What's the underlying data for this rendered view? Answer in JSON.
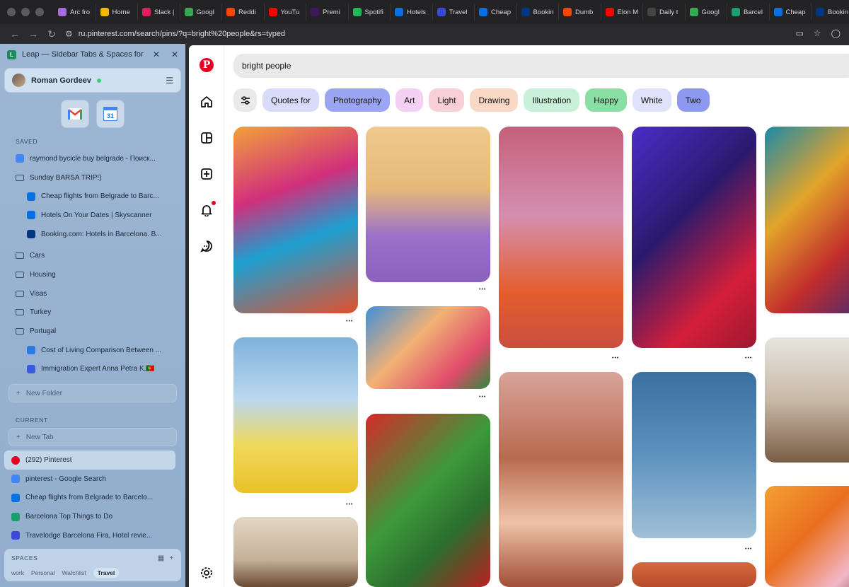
{
  "tabs": [
    {
      "label": "Arc fro",
      "icon": "arc-icon",
      "color": "#a56ddc"
    },
    {
      "label": "Home",
      "icon": "drive-icon",
      "color": "#f4b400"
    },
    {
      "label": "Slack |",
      "icon": "slack-icon",
      "color": "#e01e5a"
    },
    {
      "label": "Googl",
      "icon": "maps-icon",
      "color": "#34a853"
    },
    {
      "label": "Reddi",
      "icon": "reddit-icon",
      "color": "#ff4500"
    },
    {
      "label": "YouTu",
      "icon": "youtube-icon",
      "color": "#ff0000"
    },
    {
      "label": "Premi",
      "icon": "premier-icon",
      "color": "#3d195b"
    },
    {
      "label": "Spotifi",
      "icon": "spotify-icon",
      "color": "#1db954"
    },
    {
      "label": "Hotels",
      "icon": "skyscanner-icon",
      "color": "#0770e3"
    },
    {
      "label": "Travel",
      "icon": "travelodge-icon",
      "color": "#3b49d6"
    },
    {
      "label": "Cheap",
      "icon": "skyscanner-icon",
      "color": "#0770e3"
    },
    {
      "label": "Bookin",
      "icon": "booking-icon",
      "color": "#003580"
    },
    {
      "label": "Dumb",
      "icon": "reddit-icon",
      "color": "#ff4500"
    },
    {
      "label": "Elon M",
      "icon": "youtube-icon",
      "color": "#ff0000"
    },
    {
      "label": "Daily t",
      "icon": "notion-icon",
      "color": "#444444"
    },
    {
      "label": "Googl",
      "icon": "maps-icon",
      "color": "#34a853"
    },
    {
      "label": "Barcel",
      "icon": "viator-icon",
      "color": "#1a9e6e"
    },
    {
      "label": "Cheap",
      "icon": "skyscanner-icon",
      "color": "#0770e3"
    },
    {
      "label": "Bookin",
      "icon": "booking-icon",
      "color": "#003580"
    }
  ],
  "address": {
    "url": "ru.pinterest.com/search/pins/?q=bright%20people&rs=typed"
  },
  "sidebar": {
    "window_title": "Leap — Sidebar Tabs & Spaces for C...",
    "profile_name": "Roman Gordeev",
    "saved_label": "SAVED",
    "saved": [
      {
        "label": "raymond bycicle buy belgrade - Поиск...",
        "icon": "google-icon",
        "color": "#4285f4",
        "indent": false,
        "folder": false
      },
      {
        "label": "Sunday BARSA TRIP!)",
        "icon": "folder-open-icon",
        "indent": false,
        "folder": true
      },
      {
        "label": "Cheap flights from Belgrade to Barc...",
        "icon": "skyscanner-icon",
        "color": "#0770e3",
        "indent": true,
        "folder": false
      },
      {
        "label": "Hotels On Your Dates | Skyscanner",
        "icon": "skyscanner-icon",
        "color": "#0770e3",
        "indent": true,
        "folder": false
      },
      {
        "label": "Booking.com: Hotels in Barcelona. B...",
        "icon": "booking-icon",
        "color": "#003580",
        "indent": true,
        "folder": false
      },
      {
        "label": "Cars",
        "icon": "folder-icon",
        "indent": false,
        "folder": true
      },
      {
        "label": "Housing",
        "icon": "folder-icon",
        "indent": false,
        "folder": true
      },
      {
        "label": "Visas",
        "icon": "folder-icon",
        "indent": false,
        "folder": true
      },
      {
        "label": "Turkey",
        "icon": "folder-icon",
        "indent": false,
        "folder": true
      },
      {
        "label": "Portugal",
        "icon": "folder-open-icon",
        "indent": false,
        "folder": true
      },
      {
        "label": "Cost of Living Comparison Between ...",
        "icon": "numbeo-icon",
        "color": "#2c7be5",
        "indent": true,
        "folder": false
      },
      {
        "label": "Immigration Expert Anna Petra K.🇵🇹",
        "icon": "immigration-icon",
        "color": "#3a5bd9",
        "indent": true,
        "folder": false
      }
    ],
    "new_folder": "New Folder",
    "current_label": "CURRENT",
    "new_tab": "New Tab",
    "current": [
      {
        "label": "(292) Pinterest",
        "icon": "pinterest-icon",
        "color": "#e60023",
        "active": true
      },
      {
        "label": "pinterest - Google Search",
        "icon": "google-icon",
        "color": "#4285f4",
        "active": false
      },
      {
        "label": "Cheap flights from Belgrade to Barcelo...",
        "icon": "skyscanner-icon",
        "color": "#0770e3",
        "active": false
      },
      {
        "label": "Barcelona Top Things to Do",
        "icon": "viator-icon",
        "color": "#1a9e6e",
        "active": false
      },
      {
        "label": "Travelodge Barcelona Fira, Hotel revie...",
        "icon": "travelodge-icon",
        "color": "#3b49d6",
        "active": false
      }
    ],
    "spaces_label": "SPACES",
    "spaces": [
      {
        "label": "work",
        "active": false
      },
      {
        "label": "Personal",
        "active": false
      },
      {
        "label": "Watchlist",
        "active": false
      },
      {
        "label": "Travel",
        "active": true
      }
    ]
  },
  "search": {
    "query": "bright people"
  },
  "chips": [
    {
      "label": "Quotes for",
      "color": "#d8dcfa"
    },
    {
      "label": "Photography",
      "color": "#9aa6f2"
    },
    {
      "label": "Art",
      "color": "#f5d0f5"
    },
    {
      "label": "Light",
      "color": "#f7cfd5"
    },
    {
      "label": "Drawing",
      "color": "#f9d8c6"
    },
    {
      "label": "Illustration",
      "color": "#c9f0d9"
    },
    {
      "label": "Happy",
      "color": "#8ae0a4"
    },
    {
      "label": "White",
      "color": "#dfe2fa"
    },
    {
      "label": "Two",
      "color": "#8d99f0"
    }
  ],
  "pins": [
    {
      "name": "pin-colorful-group",
      "gradient": "linear-gradient(160deg,#f2a13a 0%,#d12f7c 35%,#1e9fd1 60%,#e2502c 100%)"
    },
    {
      "name": "pin-purple-sweater-man",
      "gradient": "linear-gradient(180deg,#efc98d 0%,#e7b979 40%,#9b71c9 70%,#8c60be 100%)"
    },
    {
      "name": "pin-laughing-girl",
      "gradient": "linear-gradient(180deg,#c4607a 0%,#d58fb0 40%,#e45d2c 75%,#c94f3f 100%)"
    },
    {
      "name": "pin-neon-portrait",
      "gradient": "linear-gradient(135deg,#4b2cc9 0%,#2a1a6e 40%,#d41e3a 75%,#9e1830 100%)"
    },
    {
      "name": "pin-painted-face",
      "gradient": "linear-gradient(135deg,#1b8aa8 0%,#e3a42b 35%,#c22c2c 65%,#2b2b7e 100%)"
    },
    {
      "name": "pin-yellow-man-sky",
      "gradient": "linear-gradient(180deg,#7fb2dc 0%,#bcd8ee 40%,#f1d85a 70%,#e9c028 100%)"
    },
    {
      "name": "pin-sunny-women",
      "gradient": "linear-gradient(135deg,#3f8fd7 0%,#f2b275 40%,#e04a6a 75%,#2f8a3c 100%)"
    },
    {
      "name": "pin-curly-woman",
      "gradient": "linear-gradient(180deg,#d9a39a 0%,#b86a4e 40%,#eec3a8 70%,#a24d37 100%)"
    },
    {
      "name": "pin-blue-sky-man",
      "gradient": "linear-gradient(180deg,#3a6fa0 0%,#5d92bf 50%,#9fc0d8 100%)"
    },
    {
      "name": "pin-happy-crowd",
      "gradient": "linear-gradient(180deg,#e7e5df 0%,#c8b9a8 50%,#7a5c44 100%)"
    },
    {
      "name": "pin-glasses-man",
      "gradient": "linear-gradient(180deg,#e4d6c4 0%,#c6b29a 60%,#6c4a32 100%)"
    },
    {
      "name": "pin-green-red-woman",
      "gradient": "linear-gradient(135deg,#d42a2a 0%,#3d9a3a 45%,#2b6d2e 70%,#b82020 100%)"
    },
    {
      "name": "pin-orange-bottom",
      "gradient": "linear-gradient(180deg,#d66a3c 0%,#b64a2c 100%)"
    },
    {
      "name": "pin-friends-orange",
      "gradient": "linear-gradient(135deg,#f4a033 0%,#e96f1f 40%,#f3b6c8 75%,#6a3e2a 100%)"
    }
  ]
}
